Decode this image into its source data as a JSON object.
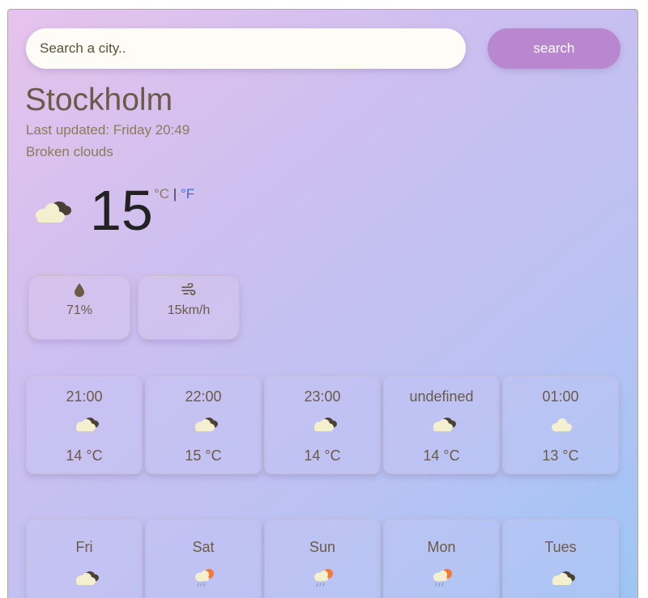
{
  "search": {
    "placeholder": "Search a city..",
    "button_label": "search"
  },
  "current": {
    "city": "Stockholm",
    "last_updated": "Last updated: Friday 20:49",
    "description": "Broken clouds",
    "icon": "broken-clouds-icon",
    "temperature": "15",
    "unit_c": "°C",
    "unit_separator": " | ",
    "unit_f": "°F",
    "humidity_icon": "drop-icon",
    "humidity": "71%",
    "wind_icon": "wind-icon",
    "wind": "15km/h"
  },
  "hourly": [
    {
      "time": "21:00",
      "icon": "broken-clouds-icon",
      "temp": "14 °C"
    },
    {
      "time": "22:00",
      "icon": "broken-clouds-icon",
      "temp": "15 °C"
    },
    {
      "time": "23:00",
      "icon": "broken-clouds-icon",
      "temp": "14 °C"
    },
    {
      "time": "undefined",
      "icon": "broken-clouds-icon",
      "temp": "14 °C"
    },
    {
      "time": "01:00",
      "icon": "few-clouds-icon",
      "temp": "13 °C"
    }
  ],
  "daily": [
    {
      "day": "Fri",
      "icon": "broken-clouds-icon"
    },
    {
      "day": "Sat",
      "icon": "rain-icon"
    },
    {
      "day": "Sun",
      "icon": "rain-icon"
    },
    {
      "day": "Mon",
      "icon": "rain-icon"
    },
    {
      "day": "Tues",
      "icon": "broken-clouds-icon"
    }
  ],
  "colors": {
    "accent_button": "#b887cf",
    "temperature_unit_link": "#3b6fe0",
    "text_primary": "#6b5a48",
    "text_secondary": "#8b7a5c"
  }
}
